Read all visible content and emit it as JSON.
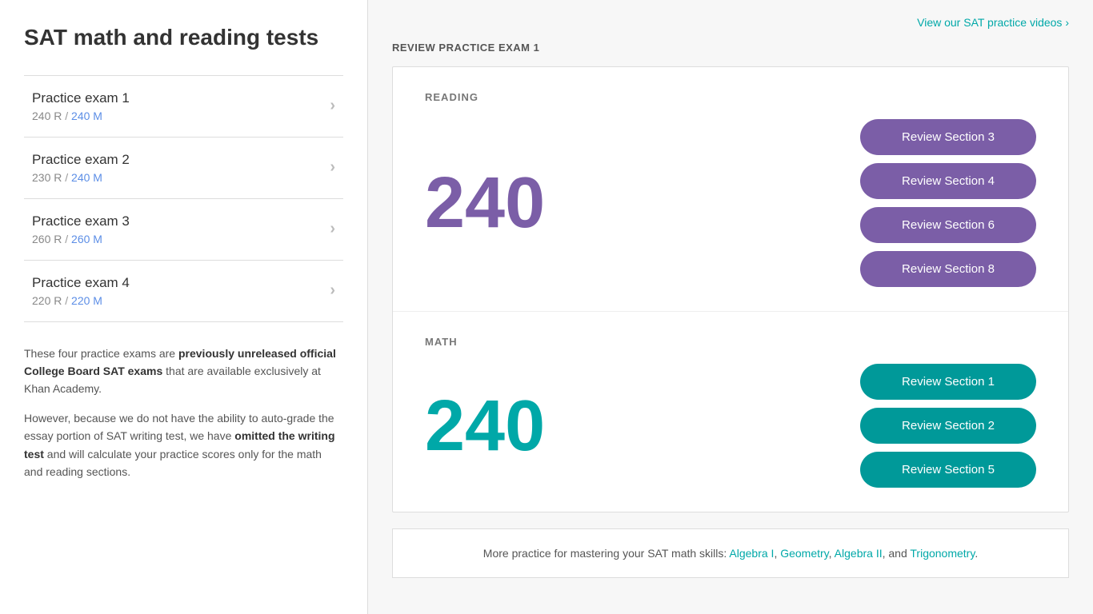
{
  "sidebar": {
    "title": "SAT math and reading tests",
    "exams": [
      {
        "name": "Practice exam 1",
        "score_r": "240 R",
        "score_m": "240 M",
        "active": true
      },
      {
        "name": "Practice exam 2",
        "score_r": "230 R",
        "score_m": "240 M",
        "active": false
      },
      {
        "name": "Practice exam 3",
        "score_r": "260 R",
        "score_m": "260 M",
        "active": false
      },
      {
        "name": "Practice exam 4",
        "score_r": "220 R",
        "score_m": "220 M",
        "active": false
      }
    ],
    "description_1": "These four practice exams are ",
    "description_bold_1": "previously unreleased official College Board SAT exams",
    "description_2": " that are available exclusively at Khan Academy.",
    "description_3": "However, because we do not have the ability to auto-grade the essay portion of SAT writing test, we have ",
    "description_bold_2": "omitted the writing test",
    "description_4": " and will calculate your practice scores only for the math and reading sections."
  },
  "main": {
    "videos_link": "View our SAT practice videos ›",
    "review_practice_label": "REVIEW PRACTICE EXAM 1",
    "reading_section": {
      "label": "READING",
      "score": "240",
      "buttons": [
        "Review Section 3",
        "Review Section 4",
        "Review Section 6",
        "Review Section 8"
      ]
    },
    "math_section": {
      "label": "MATH",
      "score": "240",
      "buttons": [
        "Review Section 1",
        "Review Section 2",
        "Review Section 5"
      ]
    },
    "footer": {
      "text_prefix": "More practice for mastering your SAT math skills:",
      "links": [
        "Algebra I",
        "Geometry",
        "Algebra II",
        "Trigonometry"
      ],
      "and_text": "and"
    }
  }
}
